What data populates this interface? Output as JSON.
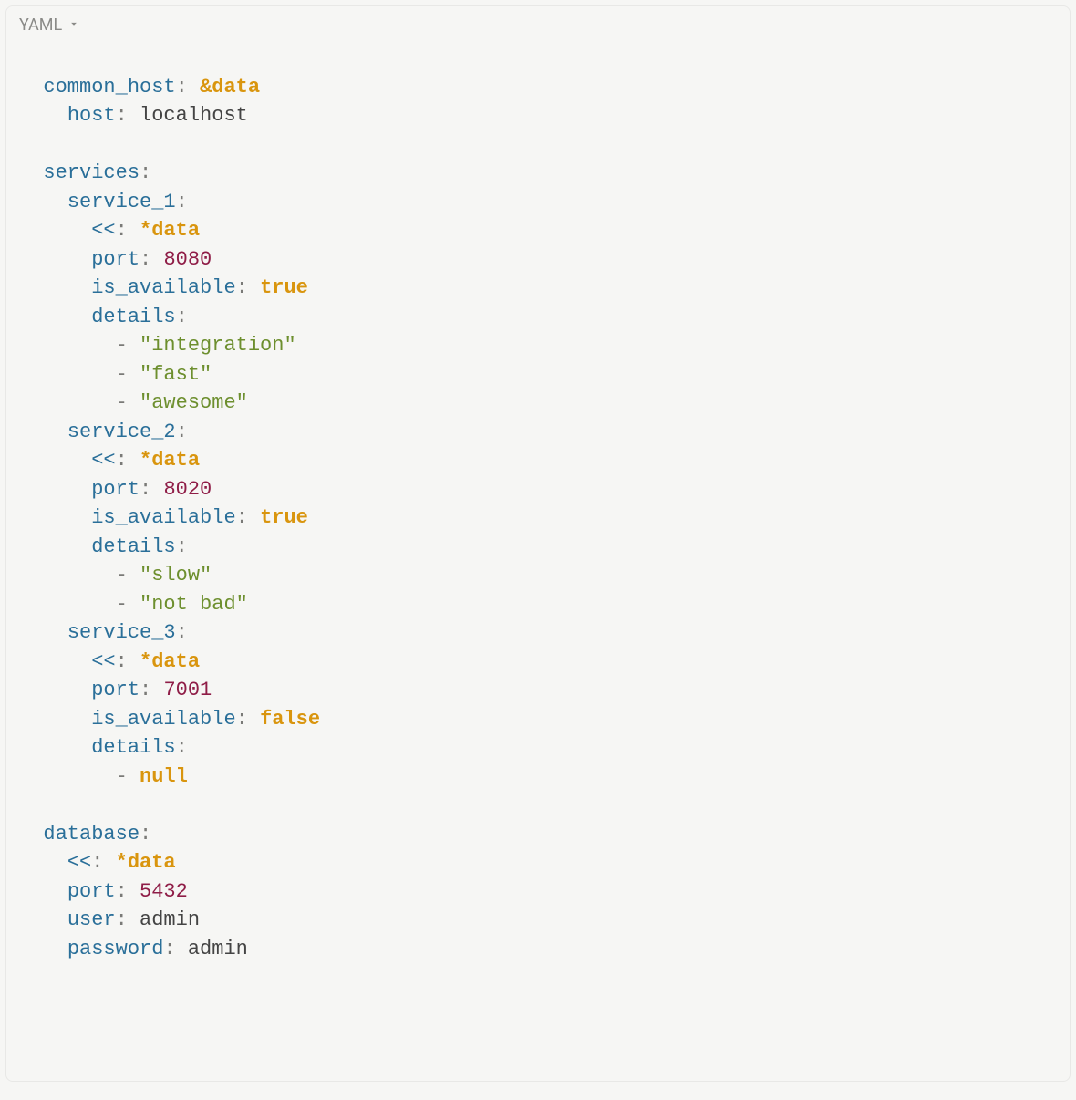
{
  "header": {
    "language_label": "YAML"
  },
  "tokens": {
    "common_host_key": "common_host",
    "common_host_anchor": "&data",
    "host_key": "host",
    "host_value": "localhost",
    "services_key": "services",
    "service_1_key": "service_1",
    "merge_key": "<<",
    "merge_ref": "*data",
    "port_key": "port",
    "is_available_key": "is_available",
    "details_key": "details",
    "true_literal": "true",
    "false_literal": "false",
    "null_literal": "null",
    "service_1_port": "8080",
    "service_1_details_0": "\"integration\"",
    "service_1_details_1": "\"fast\"",
    "service_1_details_2": "\"awesome\"",
    "service_2_key": "service_2",
    "service_2_port": "8020",
    "service_2_details_0": "\"slow\"",
    "service_2_details_1": "\"not bad\"",
    "service_3_key": "service_3",
    "service_3_port": "7001",
    "database_key": "database",
    "database_port": "5432",
    "user_key": "user",
    "user_value": "admin",
    "password_key": "password",
    "password_value": "admin"
  }
}
